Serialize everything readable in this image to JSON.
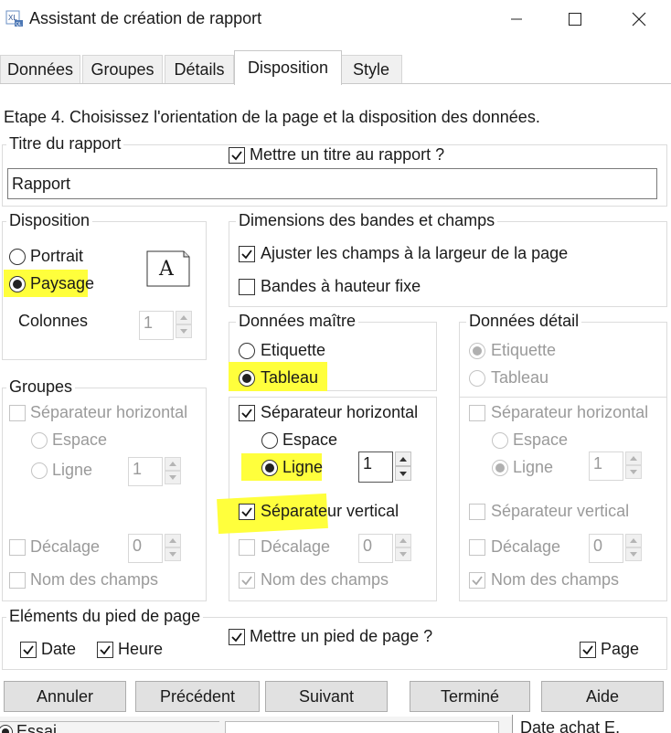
{
  "window": {
    "title": "Assistant de création de rapport",
    "minimize_icon": "minimize-icon",
    "maximize_icon": "maximize-icon",
    "close_icon": "close-icon"
  },
  "tabs": [
    {
      "label": "Données"
    },
    {
      "label": "Groupes"
    },
    {
      "label": "Détails"
    },
    {
      "label": "Disposition",
      "active": true
    },
    {
      "label": "Style"
    }
  ],
  "step_text": "Etape 4. Choisissez l'orientation de la page et la disposition des données.",
  "report_title": {
    "legend": "Titre du rapport",
    "checkbox_label": "Mettre un titre au rapport ?",
    "checked": true,
    "value": "Rapport"
  },
  "disposition": {
    "legend": "Disposition",
    "portrait": "Portrait",
    "paysage": "Paysage",
    "selected": "Paysage",
    "page_icon_letter": "A",
    "columns_label": "Colonnes",
    "columns_value": "1"
  },
  "dimensions": {
    "legend": "Dimensions des bandes et champs",
    "fit_fields": "Ajuster les champs à la largeur de la page",
    "fit_fields_checked": true,
    "fixed_height": "Bandes à hauteur fixe",
    "fixed_height_checked": false
  },
  "groups": {
    "legend": "Groupes",
    "h_separator": "Séparateur horizontal",
    "space": "Espace",
    "line": "Ligne",
    "spin_value": "1",
    "offset": "Décalage",
    "offset_value": "0",
    "field_names": "Nom des champs"
  },
  "master": {
    "legend": "Données maître",
    "label_opt": "Etiquette",
    "table_opt": "Tableau",
    "selected": "Tableau",
    "h_separator": "Séparateur horizontal",
    "h_separator_checked": true,
    "space": "Espace",
    "line": "Ligne",
    "line_selected": true,
    "spin_value": "1",
    "v_separator": "Séparateur vertical",
    "v_separator_checked": true,
    "offset": "Décalage",
    "offset_value": "0",
    "field_names": "Nom des champs",
    "field_names_checked": true
  },
  "detail": {
    "legend": "Données détail",
    "label_opt": "Etiquette",
    "table_opt": "Tableau",
    "h_separator": "Séparateur horizontal",
    "space": "Espace",
    "line": "Ligne",
    "spin_value": "1",
    "v_separator": "Séparateur vertical",
    "offset": "Décalage",
    "offset_value": "0",
    "field_names": "Nom des champs"
  },
  "footer": {
    "legend": "Eléments du pied de page",
    "date": "Date",
    "time": "Heure",
    "add_footer": "Mettre un pied de page ?",
    "page": "Page"
  },
  "buttons": {
    "cancel": "Annuler",
    "previous": "Précédent",
    "next": "Suivant",
    "finish": "Terminé",
    "help": "Aide"
  },
  "background": {
    "left_text": "Essai",
    "right_text": "Date achat E."
  },
  "colors": {
    "highlight": "#ffff3c",
    "button_face": "#e1e1e1"
  }
}
